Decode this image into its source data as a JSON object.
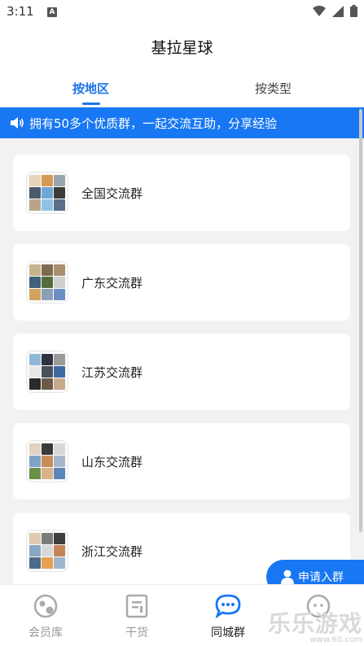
{
  "status_bar": {
    "time": "3:11",
    "notification": "A"
  },
  "header": {
    "title": "基拉星球",
    "tabs": [
      {
        "label": "按地区",
        "active": true
      },
      {
        "label": "按类型",
        "active": false
      }
    ]
  },
  "banner": {
    "text": "拥有50多个优质群，一起交流互助，分享经验"
  },
  "groups": [
    {
      "label": "全国交流群"
    },
    {
      "label": "广东交流群"
    },
    {
      "label": "江苏交流群"
    },
    {
      "label": "山东交流群"
    },
    {
      "label": "浙江交流群"
    }
  ],
  "fab": {
    "label": "申请入群"
  },
  "bottom_nav": {
    "items": [
      {
        "label": "会员库",
        "icon": "member-icon",
        "active": false
      },
      {
        "label": "干货",
        "icon": "document-icon",
        "active": false
      },
      {
        "label": "同城群",
        "icon": "chat-icon",
        "active": true
      },
      {
        "label": "",
        "icon": "profile-icon",
        "active": false
      }
    ]
  },
  "watermark": {
    "text": "乐乐游戏",
    "sub": "www.6lt.com"
  },
  "colors": {
    "accent": "#1877f2",
    "tab_active": "#1a73e8",
    "background": "#f2f2f2"
  }
}
